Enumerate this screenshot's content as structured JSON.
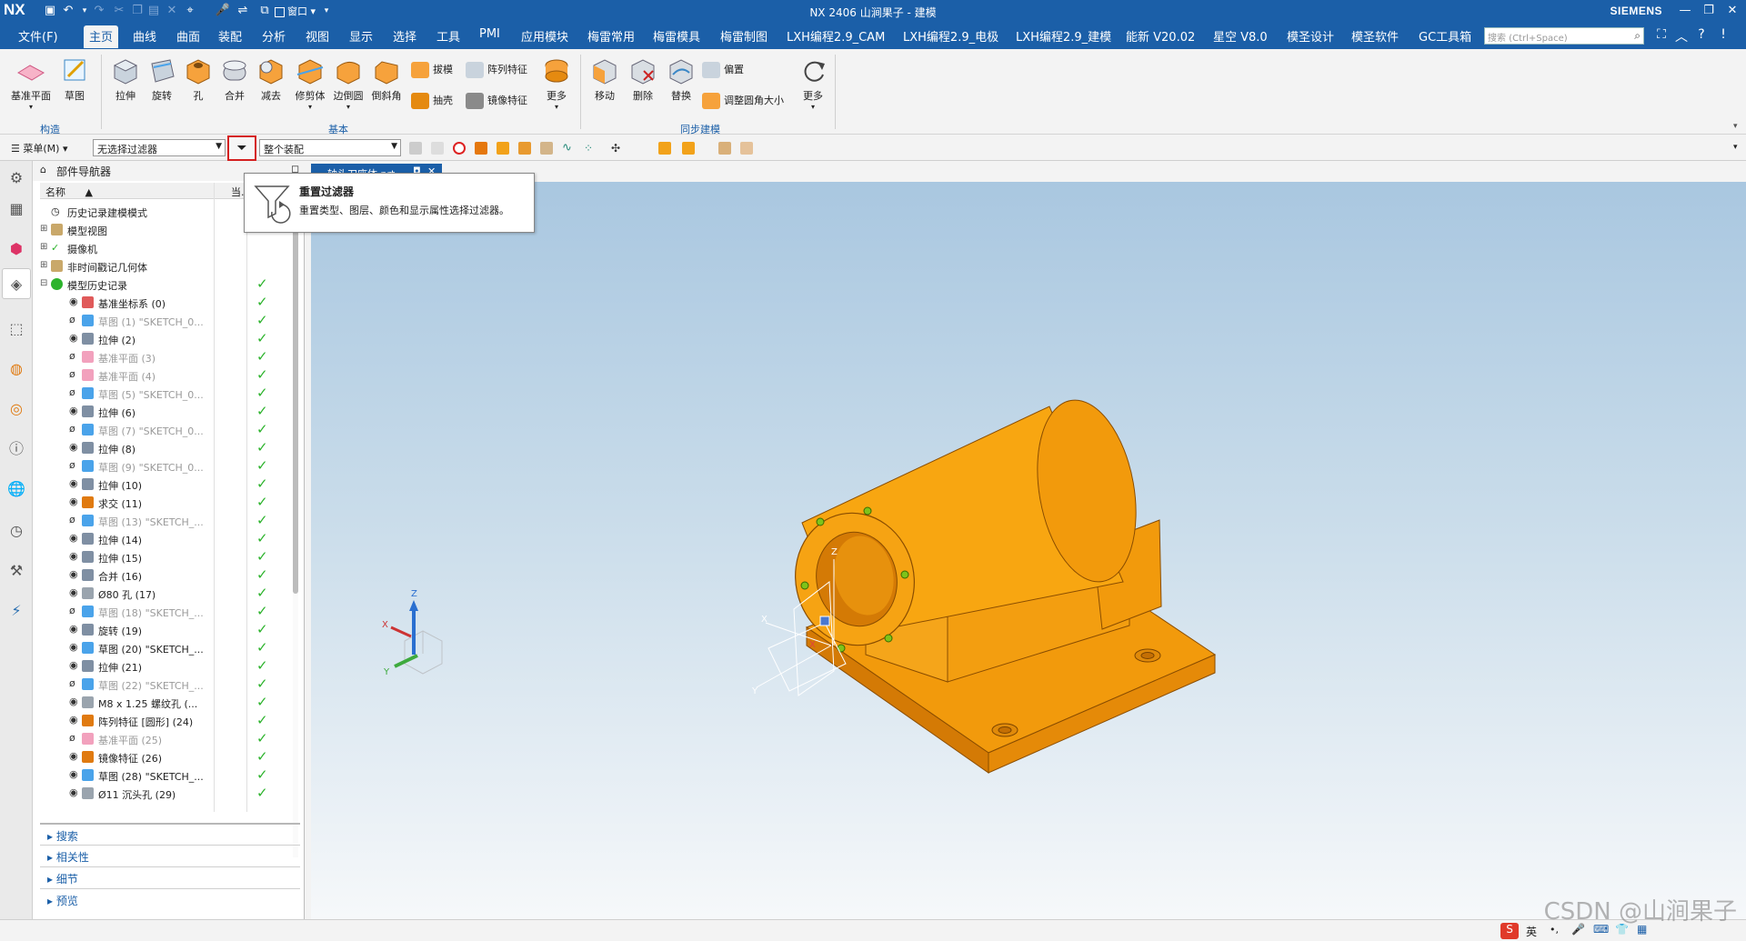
{
  "titlebar": {
    "app_logo": "NX",
    "title": "NX 2406 山涧果子 - 建模",
    "brand": "SIEMENS",
    "window_menu": "窗口"
  },
  "menu": {
    "tabs": [
      "文件(F)",
      "主页",
      "曲线",
      "曲面",
      "装配",
      "分析",
      "视图",
      "显示",
      "选择",
      "工具",
      "PMI",
      "应用模块",
      "梅雷常用",
      "梅雷模具",
      "梅雷制图",
      "LXH编程2.9_CAM",
      "LXH编程2.9_电极",
      "LXH编程2.9_建模",
      "能新 V20.02",
      "星空 V8.0",
      "模圣设计",
      "模圣软件",
      "GC工具箱"
    ],
    "active": "主页",
    "search_placeholder": "搜索 (Ctrl+Space)"
  },
  "ribbon": {
    "construct": {
      "label": "构造",
      "items": [
        "基准平面",
        "草图"
      ]
    },
    "basic": {
      "label": "基本",
      "items": [
        "拉伸",
        "旋转",
        "孔",
        "合并",
        "减去",
        "修剪体",
        "边倒圆",
        "倒斜角"
      ],
      "small": [
        "拔模",
        "阵列特征",
        "抽壳",
        "镜像特征"
      ],
      "more": "更多"
    },
    "sync": {
      "label": "同步建模",
      "items": [
        "移动",
        "删除",
        "替换"
      ],
      "small": [
        "偏置",
        "调整圆角大小"
      ],
      "more": "更多"
    }
  },
  "selbar": {
    "menu": "菜单(M)",
    "filter": "无选择过滤器",
    "scope": "整个装配"
  },
  "tooltip": {
    "title": "重置过滤器",
    "desc": "重置类型、图层、颜色和显示属性选择过滤器。"
  },
  "navigator": {
    "title": "部件导航器",
    "col_name": "名称",
    "col_current": "当...",
    "rows": [
      {
        "name": "历史记录建模模式",
        "level": 0,
        "dim": false,
        "check": false
      },
      {
        "name": "模型视图",
        "level": 0,
        "dim": false,
        "check": false
      },
      {
        "name": "摄像机",
        "level": 0,
        "dim": false,
        "check": false
      },
      {
        "name": "非时间戳记几何体",
        "level": 0,
        "dim": false,
        "check": false
      },
      {
        "name": "模型历史记录",
        "level": 0,
        "dim": false,
        "check": true
      },
      {
        "name": "基准坐标系 (0)",
        "level": 1,
        "dim": false,
        "check": true
      },
      {
        "name": "草图 (1) \"SKETCH_0...",
        "level": 1,
        "dim": true,
        "check": true
      },
      {
        "name": "拉伸 (2)",
        "level": 1,
        "dim": false,
        "check": true
      },
      {
        "name": "基准平面 (3)",
        "level": 1,
        "dim": true,
        "check": true
      },
      {
        "name": "基准平面 (4)",
        "level": 1,
        "dim": true,
        "check": true
      },
      {
        "name": "草图 (5) \"SKETCH_0...",
        "level": 1,
        "dim": true,
        "check": true
      },
      {
        "name": "拉伸 (6)",
        "level": 1,
        "dim": false,
        "check": true
      },
      {
        "name": "草图 (7) \"SKETCH_0...",
        "level": 1,
        "dim": true,
        "check": true
      },
      {
        "name": "拉伸 (8)",
        "level": 1,
        "dim": false,
        "check": true
      },
      {
        "name": "草图 (9) \"SKETCH_0...",
        "level": 1,
        "dim": true,
        "check": true
      },
      {
        "name": "拉伸 (10)",
        "level": 1,
        "dim": false,
        "check": true
      },
      {
        "name": "求交 (11)",
        "level": 1,
        "dim": false,
        "check": true
      },
      {
        "name": "草图 (13) \"SKETCH_...",
        "level": 1,
        "dim": true,
        "check": true
      },
      {
        "name": "拉伸 (14)",
        "level": 1,
        "dim": false,
        "check": true
      },
      {
        "name": "拉伸 (15)",
        "level": 1,
        "dim": false,
        "check": true
      },
      {
        "name": "合并 (16)",
        "level": 1,
        "dim": false,
        "check": true
      },
      {
        "name": "Ø80 孔 (17)",
        "level": 1,
        "dim": false,
        "check": true
      },
      {
        "name": "草图 (18) \"SKETCH_...",
        "level": 1,
        "dim": true,
        "check": true
      },
      {
        "name": "旋转 (19)",
        "level": 1,
        "dim": false,
        "check": true
      },
      {
        "name": "草图 (20) \"SKETCH_...",
        "level": 1,
        "dim": false,
        "check": true
      },
      {
        "name": "拉伸 (21)",
        "level": 1,
        "dim": false,
        "check": true
      },
      {
        "name": "草图 (22) \"SKETCH_...",
        "level": 1,
        "dim": true,
        "check": true
      },
      {
        "name": "M8 x 1.25 螺纹孔 (...",
        "level": 1,
        "dim": false,
        "check": true
      },
      {
        "name": "阵列特征 [圆形] (24)",
        "level": 1,
        "dim": false,
        "check": true
      },
      {
        "name": "基准平面 (25)",
        "level": 1,
        "dim": true,
        "check": true
      },
      {
        "name": "镜像特征 (26)",
        "level": 1,
        "dim": false,
        "check": true
      },
      {
        "name": "草图 (28) \"SKETCH_...",
        "level": 1,
        "dim": false,
        "check": true
      },
      {
        "name": "Ø11 沉头孔 (29)",
        "level": 1,
        "dim": false,
        "check": true
      }
    ],
    "sections": [
      "搜索",
      "相关性",
      "细节",
      "预览"
    ]
  },
  "doc_tab": "轴头刀座体.prt",
  "status": {
    "ime": "英"
  },
  "watermark": "CSDN @山涧果子",
  "colors": {
    "accent": "#1b5fa8",
    "part": "#f6a20c",
    "check": "#2cb32c",
    "highlight": "#d42020"
  }
}
